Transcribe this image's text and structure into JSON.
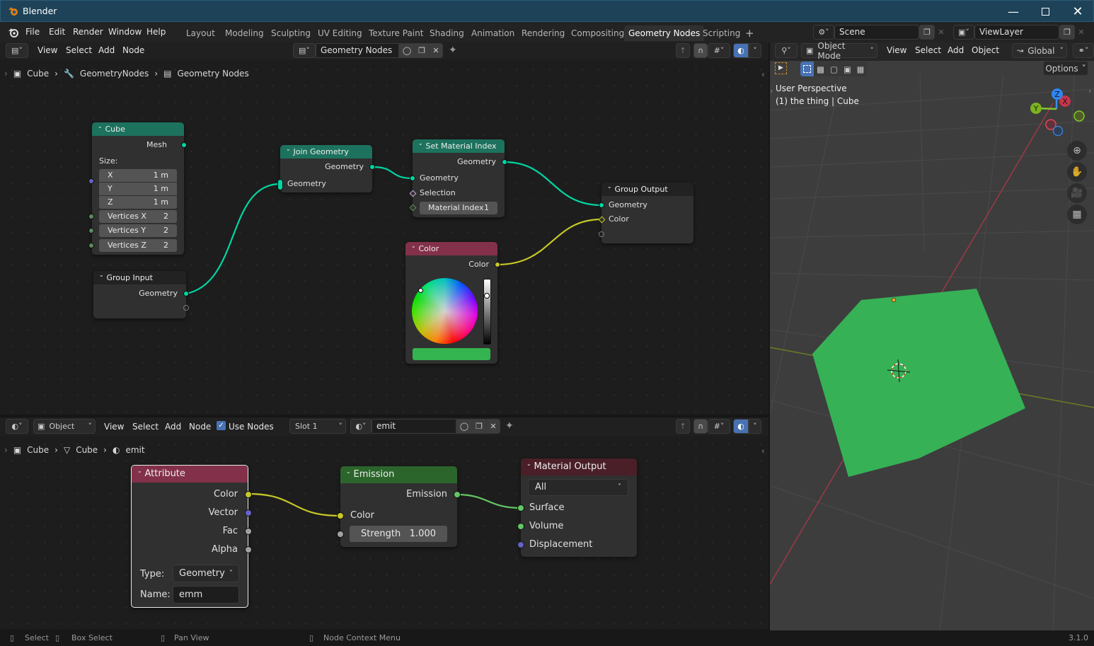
{
  "window": {
    "title": "Blender",
    "controls": [
      "minimize",
      "maximize",
      "close"
    ]
  },
  "topbar": {
    "menus": [
      "File",
      "Edit",
      "Render",
      "Window",
      "Help"
    ],
    "workspaces": [
      "Layout",
      "Modeling",
      "Sculpting",
      "UV Editing",
      "Texture Paint",
      "Shading",
      "Animation",
      "Rendering",
      "Compositing",
      "Geometry Nodes",
      "Scripting"
    ],
    "active_workspace": "Geometry Nodes",
    "add_workspace": "+",
    "scene": "Scene",
    "view_layer": "ViewLayer"
  },
  "geo_editor": {
    "menus": [
      "View",
      "Select",
      "Add",
      "Node"
    ],
    "node_group": "Geometry Nodes",
    "breadcrumb": [
      "Cube",
      "GeometryNodes",
      "Geometry Nodes"
    ],
    "nodes": {
      "cube": {
        "title": "Cube",
        "output": "Mesh",
        "size_label": "Size:",
        "size": [
          {
            "axis": "X",
            "value": "1 m"
          },
          {
            "axis": "Y",
            "value": "1 m"
          },
          {
            "axis": "Z",
            "value": "1 m"
          }
        ],
        "vertices": [
          {
            "label": "Vertices X",
            "value": "2"
          },
          {
            "label": "Vertices Y",
            "value": "2"
          },
          {
            "label": "Vertices Z",
            "value": "2"
          }
        ]
      },
      "group_input": {
        "title": "Group Input",
        "output": "Geometry"
      },
      "join": {
        "title": "Join Geometry",
        "output": "Geometry",
        "input": "Geometry"
      },
      "set_material_index": {
        "title": "Set Material Index",
        "output": "Geometry",
        "input": "Geometry",
        "selection": "Selection",
        "material_index_label": "Material Index",
        "material_index_value": "1"
      },
      "group_output": {
        "title": "Group Output",
        "inputs": [
          "Geometry",
          "Color"
        ]
      },
      "color": {
        "title": "Color",
        "output": "Color",
        "swatch": "#34b44f"
      }
    }
  },
  "shader_editor": {
    "object_mode": "Object",
    "menus": [
      "View",
      "Select",
      "Add",
      "Node"
    ],
    "use_nodes_label": "Use Nodes",
    "use_nodes": true,
    "slot": "Slot 1",
    "material": "emit",
    "breadcrumb": [
      "Cube",
      "Cube",
      "emit"
    ],
    "nodes": {
      "attribute": {
        "title": "Attribute",
        "outputs": [
          "Color",
          "Vector",
          "Fac",
          "Alpha"
        ],
        "type_label": "Type:",
        "type_value": "Geometry",
        "name_label": "Name:",
        "name_value": "emm"
      },
      "emission": {
        "title": "Emission",
        "output": "Emission",
        "input": "Color",
        "strength_label": "Strength",
        "strength_value": "1.000"
      },
      "material_output": {
        "title": "Material Output",
        "target": "All",
        "inputs": [
          "Surface",
          "Volume",
          "Displacement"
        ]
      }
    }
  },
  "viewport": {
    "mode": "Object Mode",
    "menus": [
      "View",
      "Select",
      "Add",
      "Object"
    ],
    "orientation": "Global",
    "options_label": "Options",
    "overlay_line1": "User Perspective",
    "overlay_line2": "(1) the thing | Cube",
    "gizmo_axes": [
      "X",
      "Y",
      "Z"
    ],
    "mesh_color": "#36b155"
  },
  "statusbar": {
    "items": [
      "Select",
      "Box Select",
      "Pan View",
      "Node Context Menu"
    ],
    "version": "3.1.0"
  },
  "colors": {
    "geometry_socket": "#00d6a3",
    "color_socket": "#c7c729",
    "shader_socket": "#63c763",
    "vector_socket": "#6363c7",
    "float_socket": "#a1a1a1",
    "int_socket": "#598c5c",
    "geo_header": "#1d725e",
    "color_header": "#83314a",
    "emission_header": "#2b652b",
    "output_header": "#4a1f28",
    "accent": "#4772b3"
  }
}
